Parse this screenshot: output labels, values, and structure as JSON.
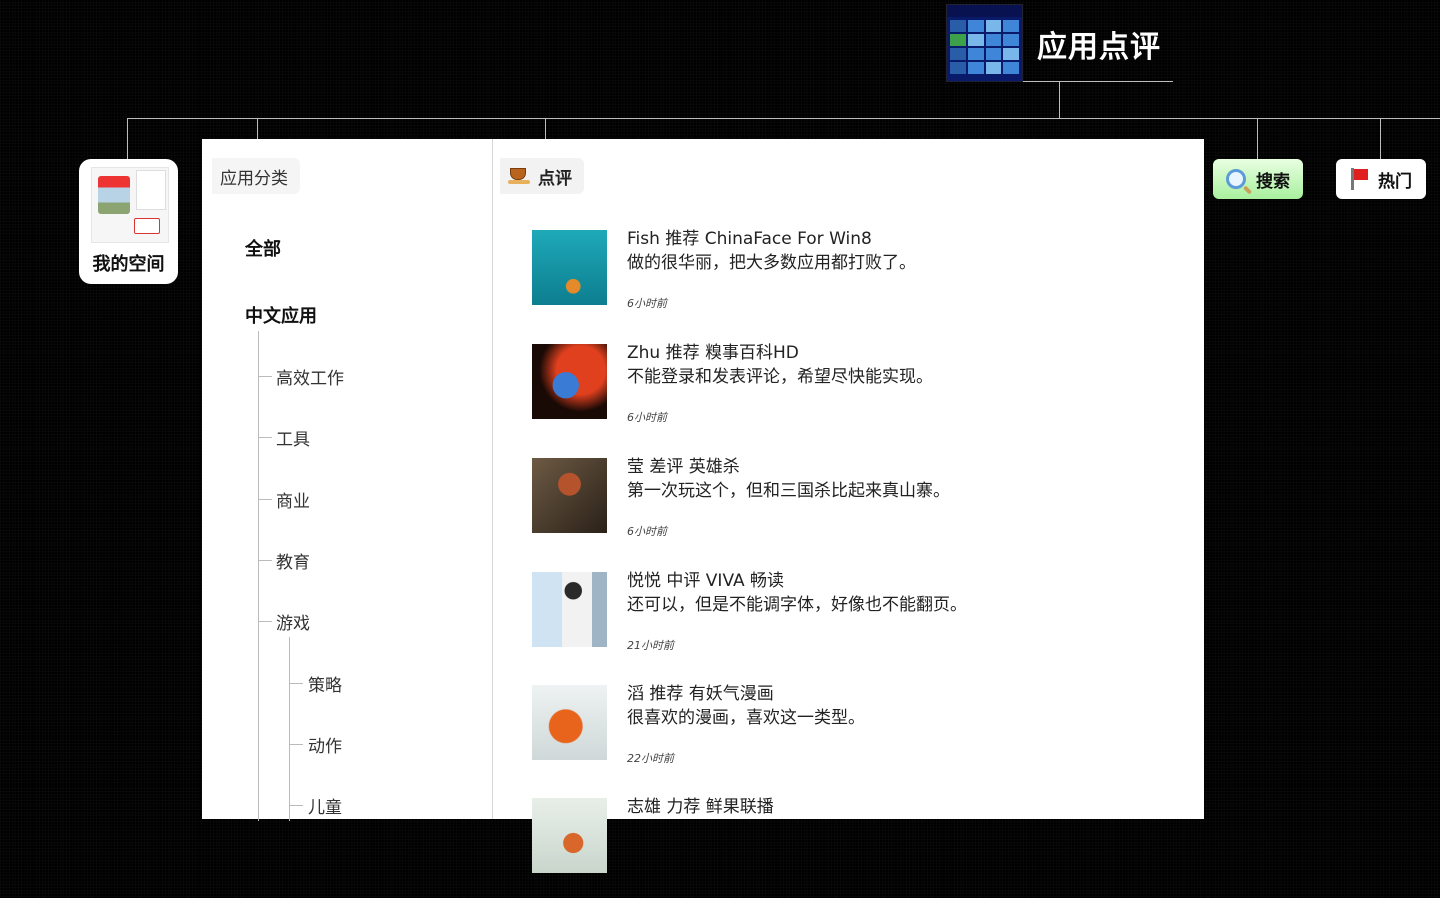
{
  "header": {
    "title": "应用点评"
  },
  "nav": {
    "my_space": "我的空间",
    "search": "搜索",
    "hot": "热门"
  },
  "categories": {
    "section_title": "应用分类",
    "items": [
      {
        "label": "全部"
      },
      {
        "label": "中文应用"
      },
      {
        "label": "高效工作"
      },
      {
        "label": "工具"
      },
      {
        "label": "商业"
      },
      {
        "label": "教育"
      },
      {
        "label": "游戏"
      },
      {
        "label": "策略"
      },
      {
        "label": "动作"
      },
      {
        "label": "儿童"
      }
    ]
  },
  "reviews": {
    "section_title": "点评",
    "items": [
      {
        "head": "Fish 推荐 ChinaFace For Win8",
        "body": "做的很华丽，把大多数应用都打败了。",
        "time": "6小时前"
      },
      {
        "head": "Zhu 推荐 糗事百科HD",
        "body": "不能登录和发表评论，希望尽快能实现。",
        "time": "6小时前"
      },
      {
        "head": "莹 差评 英雄杀",
        "body": "第一次玩这个，但和三国杀比起来真山寨。",
        "time": "6小时前"
      },
      {
        "head": "悦悦 中评 VIVA 畅读",
        "body": "还可以，但是不能调字体，好像也不能翻页。",
        "time": "21小时前"
      },
      {
        "head": "滔 推荐 有妖气漫画",
        "body": "很喜欢的漫画，喜欢这一类型。",
        "time": "22小时前"
      },
      {
        "head": "志雄 力荐 鲜果联播",
        "body": "",
        "time": ""
      }
    ]
  }
}
